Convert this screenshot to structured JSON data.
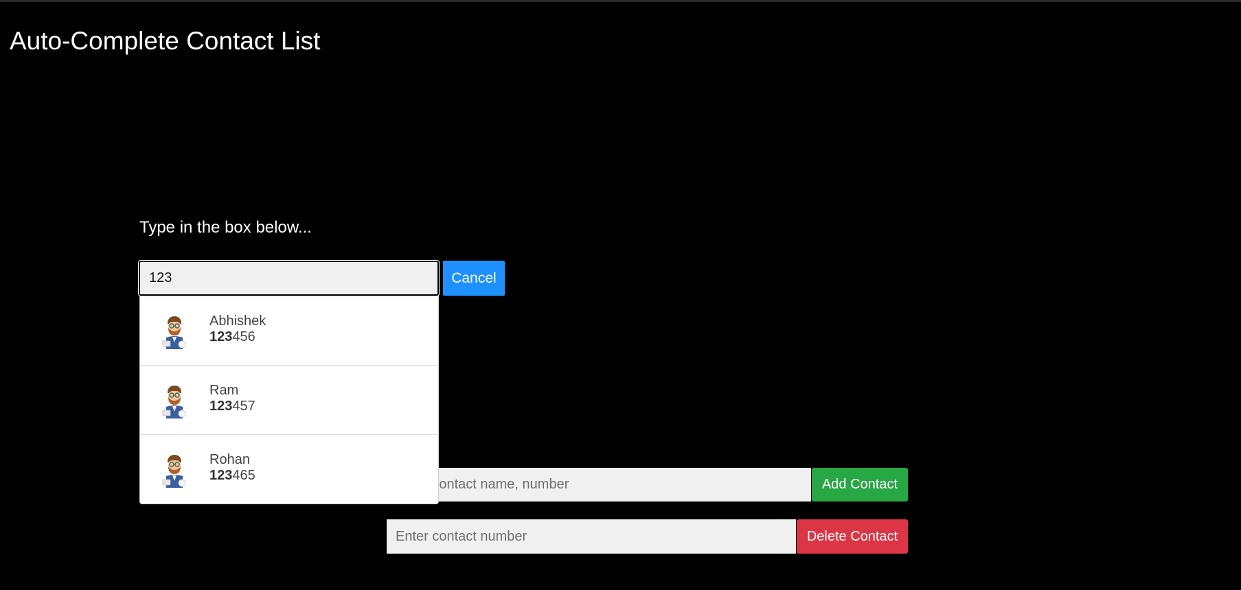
{
  "page": {
    "title": "Auto-Complete Contact List",
    "prompt": "Type in the box below..."
  },
  "search": {
    "value": "123",
    "cancel_label": "Cancel"
  },
  "suggestions": [
    {
      "name": "Abhishek",
      "number_match": "123",
      "number_rest": "456",
      "icon": "avatar-icon"
    },
    {
      "name": "Ram",
      "number_match": "123",
      "number_rest": "457",
      "icon": "avatar-icon"
    },
    {
      "name": "Rohan",
      "number_match": "123",
      "number_rest": "465",
      "icon": "avatar-icon"
    }
  ],
  "add_contact": {
    "placeholder": "Enter contact name, number",
    "button_label": "Add Contact"
  },
  "delete_contact": {
    "placeholder": "Enter contact number",
    "button_label": "Delete Contact"
  },
  "colors": {
    "background": "#000000",
    "cancel": "#1e90ff",
    "add": "#28a745",
    "delete": "#dc3545"
  }
}
